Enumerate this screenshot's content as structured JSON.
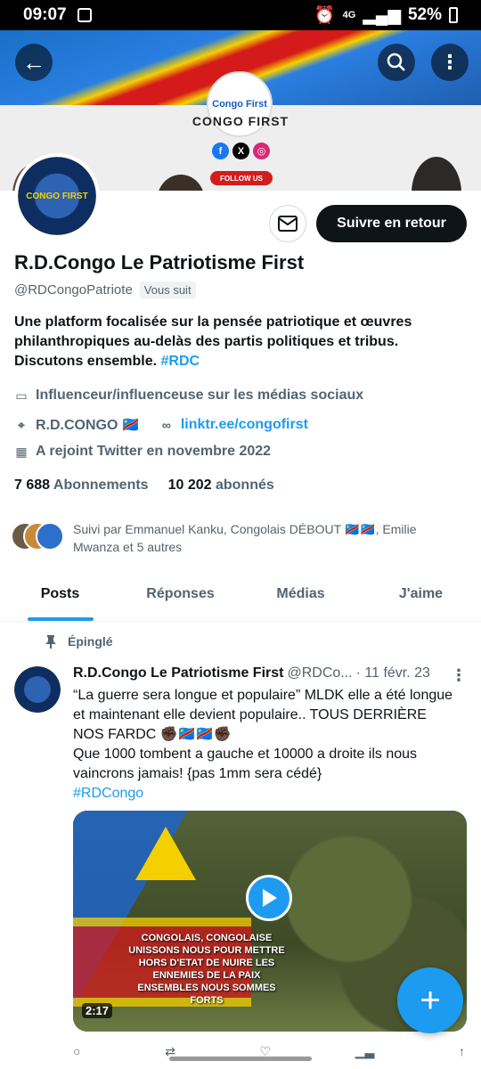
{
  "status_bar": {
    "time": "09:07",
    "network": "4G",
    "battery": "52%"
  },
  "banner": {
    "logo_text": "Congo First",
    "title": "CONGO FIRST",
    "follow_label": "FOLLOW US"
  },
  "header": {
    "back_icon": "arrow-left-icon",
    "search_icon": "search-icon",
    "more_icon": "more-vertical-icon"
  },
  "profile": {
    "avatar_text": "CONGO FIRST",
    "follow_back_label": "Suivre en retour",
    "name": "R.D.Congo Le Patriotisme First",
    "handle": "@RDCongoPatriote",
    "follows_you": "Vous suit",
    "bio_text": "Une platform focalisée sur la pensée patriotique et œuvres philanthropiques au-delàs des partis politiques et tribus. Discutons ensemble. ",
    "bio_tag": "#RDC",
    "category": "Influenceur/influenceuse sur les médias sociaux",
    "location": "R.D.CONGO 🇨🇩",
    "link": "linktr.ee/congofirst",
    "joined": "A rejoint Twitter en novembre 2022",
    "following_count": "7 688",
    "following_label": "Abonnements",
    "followers_count": "10 202",
    "followers_label": "abonnés",
    "followed_by": "Suivi par Emmanuel Kanku, Congolais DÉBOUT 🇨🇩🇨🇩, Emilie Mwanza et 5 autres"
  },
  "tabs": [
    "Posts",
    "Réponses",
    "Médias",
    "J'aime"
  ],
  "post": {
    "pinned_label": "Épinglé",
    "author": "R.D.Congo Le Patriotisme First",
    "handle": "@RDCo...",
    "date": "· 11 févr. 23",
    "text_line1": "“La guerre sera longue et populaire” MLDK elle a été longue et maintenant elle devient populaire.. TOUS DERRIÈRE NOS FARDC ✊🏿🇨🇩🇨🇩✊🏿",
    "text_line2": "Que 1000 tombent a gauche  et 10000 a droite ils nous vaincrons jamais! {pas 1mm sera cédé}",
    "tag": "#RDCongo",
    "media_caption": "CONGOLAIS, CONGOLAISE UNISSONS NOUS POUR METTRE HORS D'ETAT DE NUIRE LES ENNEMIES DE LA PAIX ENSEMBLES NOUS SOMMES FORTS",
    "duration": "2:17"
  },
  "colors": {
    "accent": "#1d9bf0",
    "text": "#0f1419",
    "muted": "#536471"
  }
}
